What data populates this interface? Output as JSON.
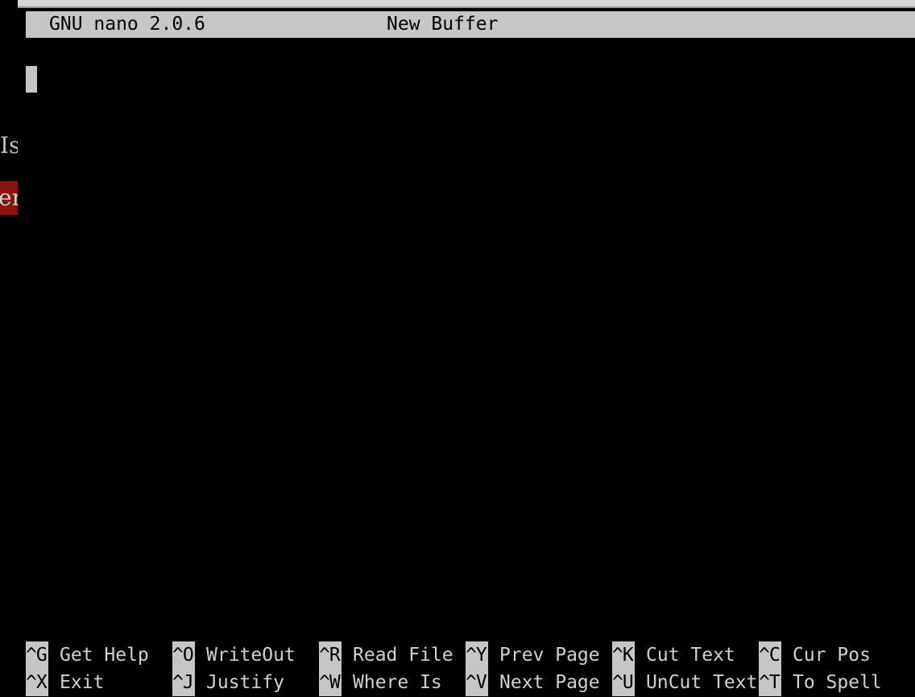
{
  "title_bar": {
    "app": "GNU nano 2.0.6",
    "buffer": "New Buffer"
  },
  "background_fragments": {
    "line1": "Is",
    "line2": "er"
  },
  "shortcuts": {
    "row1": [
      {
        "key": "^G",
        "label": "Get Help"
      },
      {
        "key": "^O",
        "label": "WriteOut"
      },
      {
        "key": "^R",
        "label": "Read File"
      },
      {
        "key": "^Y",
        "label": "Prev Page"
      },
      {
        "key": "^K",
        "label": "Cut Text"
      },
      {
        "key": "^C",
        "label": "Cur Pos"
      }
    ],
    "row2": [
      {
        "key": "^X",
        "label": "Exit"
      },
      {
        "key": "^J",
        "label": "Justify"
      },
      {
        "key": "^W",
        "label": "Where Is"
      },
      {
        "key": "^V",
        "label": "Next Page"
      },
      {
        "key": "^U",
        "label": "UnCut Text"
      },
      {
        "key": "^T",
        "label": "To Spell"
      }
    ]
  },
  "colors": {
    "background": "#000000",
    "bar": "#c6c6c6",
    "highlight_red": "#8c1111"
  }
}
